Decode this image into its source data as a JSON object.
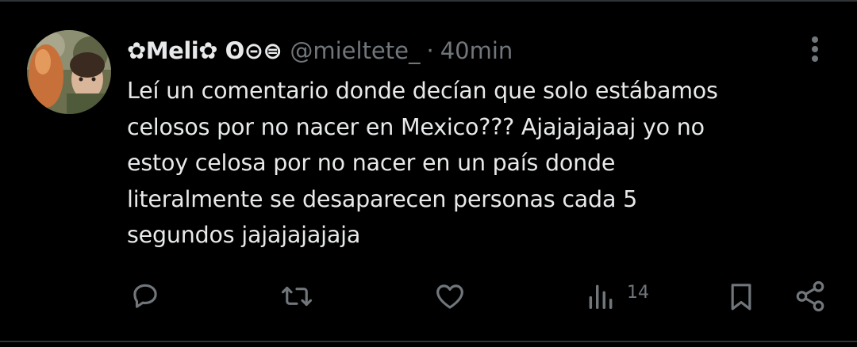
{
  "tweet": {
    "display_name": "✿Meli✿ ʘ⊝⊜",
    "handle": "@mieltete_",
    "separator": "·",
    "time": "40min",
    "text_lines": [
      "Leí un comentario donde decían que solo estábamos",
      "celosos por no nacer en Mexico??? Ajajajajaaj yo no",
      "estoy celosa por no nacer en un país donde",
      "literalmente se desaparecen personas cada 5",
      "segundos jajajajajaja"
    ]
  },
  "actions": {
    "reply_icon": "reply-icon",
    "retweet_icon": "retweet-icon",
    "like_icon": "heart-icon",
    "views_icon": "views-chart-icon",
    "views_count": "14",
    "bookmark_icon": "bookmark-icon",
    "share_icon": "share-icon"
  },
  "colors": {
    "background": "#000000",
    "text_primary": "#e7e9ea",
    "text_secondary": "#71767b",
    "divider": "#2f3336"
  }
}
